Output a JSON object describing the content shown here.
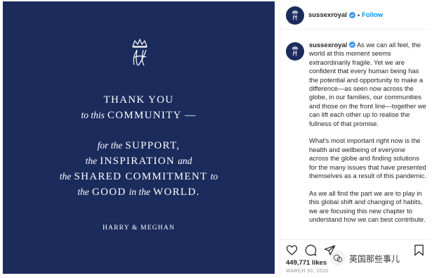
{
  "post": {
    "lines": {
      "l1": "THANK YOU",
      "l2a": "to this",
      "l2b": "COMMUNITY —",
      "l3a": "for the",
      "l3b": "SUPPORT,",
      "l4a": "the",
      "l4b": "INSPIRATION",
      "l4c": "and",
      "l5a": "the",
      "l5b": "SHARED COMMITMENT",
      "l5c": "to",
      "l6a": "the",
      "l6b": "GOOD",
      "l6c": "in the",
      "l6d": "WORLD."
    },
    "signature": "HARRY & MEGHAN",
    "background": "#1b2b5c"
  },
  "header": {
    "username": "sussexroyal",
    "separator": "•",
    "follow_label": "Follow"
  },
  "caption": {
    "username": "sussexroyal",
    "paragraphs": [
      "As we can all feel, the world at this moment seems extraordinarily fragile. Yet we are confident that every human being has the potential and opportunity to make a difference—as seen now across the globe, in our families, our communities and those on the front line—together we can lift each other up to realise the fullness of that promise.",
      "What's most important right now is the health and wellbeing of everyone across the globe and finding solutions for the many issues that have presented themselves as a result of this pandemic.",
      "As we all find the part we are to play in this global shift and changing of habits, we are focusing this new chapter to understand how we can best contribute."
    ]
  },
  "actions": {
    "likes": "449,771 likes",
    "date": "MARCH 30, 2020"
  },
  "watermark": {
    "text": "英国那些事儿"
  },
  "colors": {
    "accent": "#0095f6",
    "navy": "#1b2b5c"
  }
}
